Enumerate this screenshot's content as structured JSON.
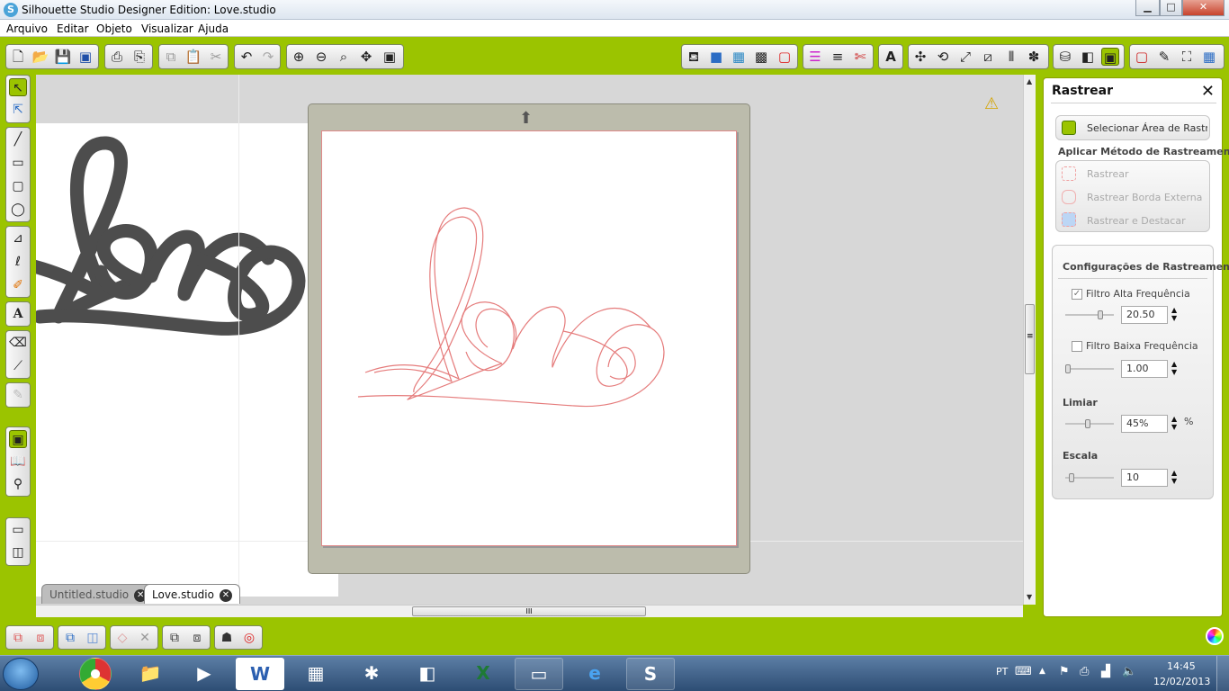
{
  "window": {
    "title": "Silhouette Studio Designer Edition: Love.studio",
    "app_icon": "S",
    "buttons": {
      "minimize": "▁",
      "maximize": "□",
      "close": "✕"
    }
  },
  "menu": [
    "Arquivo",
    "Editar",
    "Objeto",
    "Visualizar",
    "Ajuda"
  ],
  "tabs": [
    {
      "label": "Untitled.studio",
      "active": false
    },
    {
      "label": "Love.studio",
      "active": true
    }
  ],
  "canvas": {
    "design_text_left": "Love",
    "design_text_traced": "Love",
    "warning_icon": "⚠",
    "mat_arrow": "⬆"
  },
  "panel": {
    "title": "Rastrear",
    "close": "✕",
    "select_area": "Selecionar Área de Rastrea",
    "apply_method": "Aplicar Método de Rastreamento",
    "methods": [
      "Rastrear",
      "Rastrear Borda Externa",
      "Rastrear e Destacar"
    ],
    "settings_title": "Configurações de Rastreament",
    "high_filter": {
      "label": "Filtro Alta Frequência",
      "checked": true,
      "value": "20.50"
    },
    "low_filter": {
      "label": "Filtro Baixa Frequência",
      "checked": false,
      "value": "1.00"
    },
    "threshold": {
      "label": "Limiar",
      "value": "45%",
      "unit": "%"
    },
    "scale": {
      "label": "Escala",
      "value": "10"
    }
  },
  "scrollbar": {
    "grip": "≡",
    "hgrip": "III",
    "up": "▲",
    "down": "▼"
  },
  "tray": {
    "lang": "PT",
    "time": "14:45",
    "date": "12/02/2013"
  },
  "colors": {
    "accent": "#9bc400",
    "trace": "#e57b7b",
    "shape": "#4d4d4d"
  }
}
